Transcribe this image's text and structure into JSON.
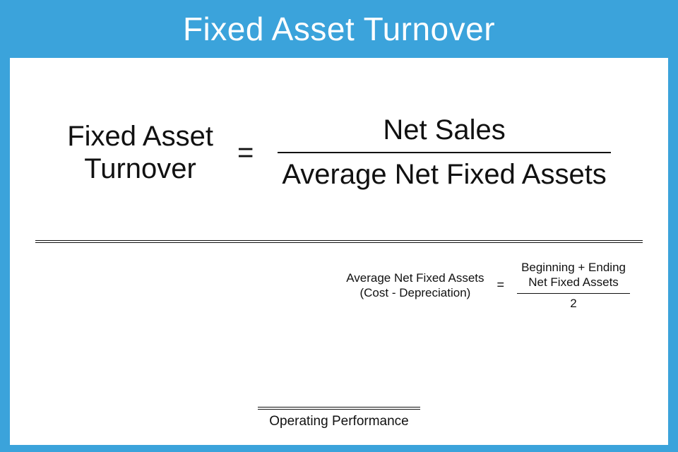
{
  "title": "Fixed Asset Turnover",
  "main_formula": {
    "lhs_line1": "Fixed Asset",
    "lhs_line2": "Turnover",
    "equals": "=",
    "numerator": "Net Sales",
    "denominator": "Average Net Fixed Assets"
  },
  "sub_formula": {
    "lhs_line1": "Average Net Fixed Assets",
    "lhs_line2": "(Cost - Depreciation)",
    "equals": "=",
    "num_line1": "Beginning + Ending",
    "num_line2": "Net Fixed Assets",
    "denominator": "2"
  },
  "footer": "Operating Performance"
}
